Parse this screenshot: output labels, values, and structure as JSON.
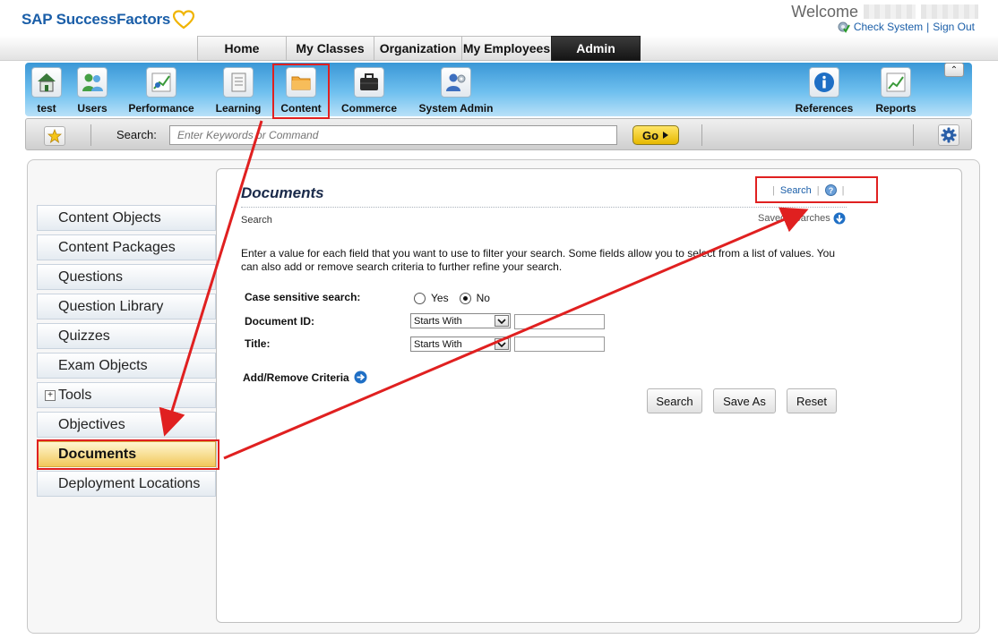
{
  "header": {
    "logo_text": "SAP SuccessFactors",
    "welcome": "Welcome",
    "check_system": "Check System",
    "sign_out": "Sign Out",
    "link_separator": "|"
  },
  "top_nav": [
    {
      "label": "Home",
      "active": false
    },
    {
      "label": "My Classes",
      "active": false
    },
    {
      "label": "Organization",
      "active": false
    },
    {
      "label": "My Employees",
      "active": false
    },
    {
      "label": "Admin",
      "active": true
    }
  ],
  "toolbar": {
    "items": [
      {
        "label": "test",
        "icon": "house-icon"
      },
      {
        "label": "Users",
        "icon": "users-icon"
      },
      {
        "label": "Performance",
        "icon": "performance-chart-icon"
      },
      {
        "label": "Learning",
        "icon": "document-icon"
      },
      {
        "label": "Content",
        "icon": "folder-icon",
        "highlighted": true
      },
      {
        "label": "Commerce",
        "icon": "briefcase-icon"
      },
      {
        "label": "System Admin",
        "icon": "system-admin-icon"
      },
      {
        "label": "References",
        "icon": "info-icon"
      },
      {
        "label": "Reports",
        "icon": "reports-chart-icon"
      }
    ],
    "collapse_glyph": "⌃"
  },
  "search_bar": {
    "label": "Search:",
    "placeholder": "Enter Keywords or Command",
    "go_label": "Go"
  },
  "sidebar": {
    "items": [
      {
        "label": "Content Objects"
      },
      {
        "label": "Content Packages"
      },
      {
        "label": "Questions"
      },
      {
        "label": "Question Library"
      },
      {
        "label": "Quizzes"
      },
      {
        "label": "Exam Objects"
      },
      {
        "label": "Tools",
        "expandable": true
      },
      {
        "label": "Objectives"
      },
      {
        "label": "Documents",
        "selected": true
      },
      {
        "label": "Deployment Locations"
      }
    ]
  },
  "content": {
    "title": "Documents",
    "subtitle": "Search",
    "header_link_search": "Search",
    "saved_searches": "Saved Searches",
    "instructions": "Enter a value for each field that you want to use to filter your search. Some fields allow you to select from a list of values. You can also add or remove search criteria to further refine your search.",
    "form": {
      "case_label": "Case sensitive search:",
      "case_yes": "Yes",
      "case_no": "No",
      "case_selected": "No",
      "docid_label": "Document ID:",
      "docid_operator": "Starts With",
      "docid_value": "",
      "title_label": "Title:",
      "title_operator": "Starts With",
      "title_value": ""
    },
    "add_remove_criteria": "Add/Remove Criteria",
    "buttons": {
      "search": "Search",
      "save_as": "Save As",
      "reset": "Reset"
    }
  },
  "colors": {
    "brand_blue": "#1a5ea8",
    "annotation_red": "#e02020",
    "toolbar_gradient_top": "#3a97d6",
    "selected_item": "#f1c85c"
  }
}
